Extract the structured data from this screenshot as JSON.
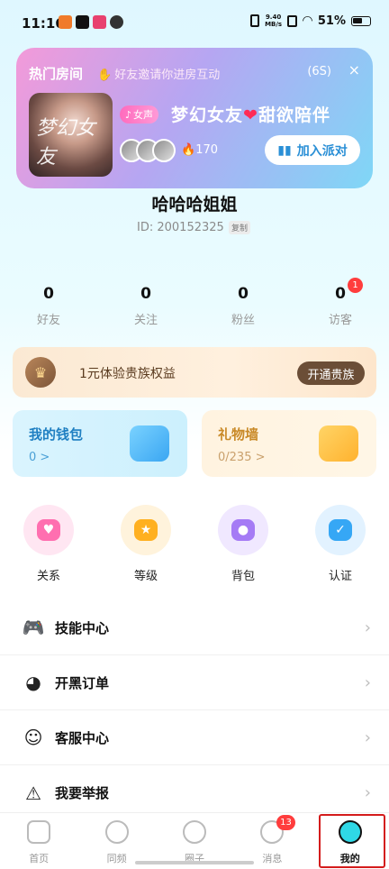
{
  "status_bar": {
    "time": "11:16",
    "net_speed_value": "9.40",
    "net_speed_unit": "MB/s",
    "battery": "51%"
  },
  "hot_room": {
    "title": "热门房间",
    "subtitle": "好友邀请你进房互动",
    "countdown": "(6S)",
    "close_symbol": "×",
    "cover_text": "梦幻女友",
    "tag": "女声",
    "room_name_part1": "梦幻女友",
    "room_name_part2": "甜欲陪伴",
    "heat": "170",
    "join_label": "加入派对"
  },
  "profile": {
    "username": "哈哈哈姐姐",
    "id_text": "ID: 200152325",
    "copy_label": "复制"
  },
  "stats": [
    {
      "value": "0",
      "label": "好友"
    },
    {
      "value": "0",
      "label": "关注"
    },
    {
      "value": "0",
      "label": "粉丝"
    },
    {
      "value": "0",
      "label": "访客",
      "badge": "1"
    }
  ],
  "noble": {
    "text": "1元体验贵族权益",
    "button": "开通贵族"
  },
  "wallet": {
    "title": "我的钱包",
    "value": "0 >"
  },
  "gift_wall": {
    "title": "礼物墙",
    "value": "0/235 >"
  },
  "quick_items": [
    {
      "label": "关系",
      "icon": "heart-icon",
      "color": "#ff6fb0"
    },
    {
      "label": "等级",
      "icon": "level-badge-icon",
      "color": "#ffb020"
    },
    {
      "label": "背包",
      "icon": "backpack-icon",
      "color": "#a57bf5"
    },
    {
      "label": "认证",
      "icon": "verified-shield-icon",
      "color": "#36a7f5"
    }
  ],
  "menu": [
    {
      "label": "技能中心",
      "icon": "gamepad-icon"
    },
    {
      "label": "开黑订单",
      "icon": "pacman-icon"
    },
    {
      "label": "客服中心",
      "icon": "customer-service-icon"
    },
    {
      "label": "我要举报",
      "icon": "warning-icon"
    }
  ],
  "tabs": [
    {
      "label": "首页",
      "icon": "home-icon"
    },
    {
      "label": "同频",
      "icon": "music-disc-icon"
    },
    {
      "label": "圈子",
      "icon": "planet-icon"
    },
    {
      "label": "消息",
      "icon": "chat-bubble-icon",
      "badge": "13"
    },
    {
      "label": "我的",
      "icon": "profile-face-icon",
      "active": true
    }
  ]
}
